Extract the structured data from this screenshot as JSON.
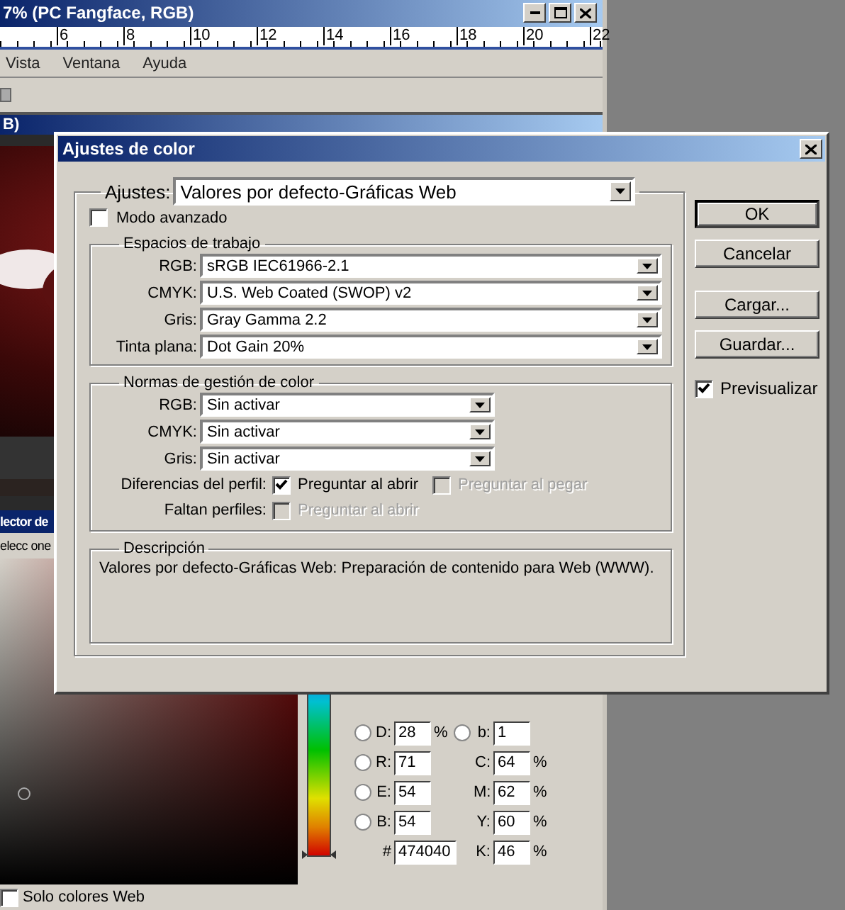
{
  "app_window": {
    "title": "7% (PC Fangface, RGB)",
    "ruler_labels": [
      "6",
      "8",
      "10",
      "12",
      "14",
      "16",
      "18",
      "20",
      "22"
    ],
    "menu": [
      "Vista",
      "Ventana",
      "Ayuda"
    ],
    "document_title": "B)",
    "canvas": {
      "kind": "picture"
    }
  },
  "color_picker": {
    "title": "lector de",
    "subtitle": "elecc one",
    "rows": [
      {
        "left": {
          "kind": "radio",
          "label": "D:",
          "value": "28",
          "unit": "%",
          "selected": false
        },
        "right": {
          "kind": "radio",
          "label": "b:",
          "value": "1",
          "selected": false
        }
      },
      {
        "left": {
          "kind": "radio",
          "label": "R:",
          "value": "71",
          "selected": false
        },
        "right": {
          "kind": "plain",
          "label": "C:",
          "value": "64",
          "unit": "%"
        }
      },
      {
        "left": {
          "kind": "radio",
          "label": "E:",
          "value": "54",
          "selected": false
        },
        "right": {
          "kind": "plain",
          "label": "M:",
          "value": "62",
          "unit": "%"
        }
      },
      {
        "left": {
          "kind": "radio",
          "label": "B:",
          "value": "54",
          "selected": false
        },
        "right": {
          "kind": "plain",
          "label": "Y:",
          "value": "60",
          "unit": "%"
        }
      },
      {
        "left": {
          "kind": "hex",
          "label": "#",
          "value": "474040"
        },
        "right": {
          "kind": "plain",
          "label": "K:",
          "value": "46",
          "unit": "%"
        }
      }
    ],
    "hue_slider": {
      "level": 0
    },
    "web_only": {
      "label": "Solo colores Web",
      "checked": false
    }
  },
  "dialog": {
    "title": "Ajustes de color",
    "settings": {
      "label": "Ajustes:",
      "value": "Valores por defecto-Gráficas Web"
    },
    "advanced_mode": {
      "label": "Modo avanzado",
      "checked": false
    },
    "working_spaces": {
      "title": "Espacios de trabajo",
      "rows": [
        {
          "label": "RGB:",
          "value": "sRGB IEC61966-2.1"
        },
        {
          "label": "CMYK:",
          "value": "U.S. Web Coated (SWOP) v2"
        },
        {
          "label": "Gris:",
          "value": "Gray Gamma 2.2"
        },
        {
          "label": "Tinta plana:",
          "value": "Dot Gain 20%"
        }
      ]
    },
    "policies": {
      "title": "Normas de gestión de color",
      "rows": [
        {
          "label": "RGB:",
          "value": "Sin activar"
        },
        {
          "label": "CMYK:",
          "value": "Sin activar"
        },
        {
          "label": "Gris:",
          "value": "Sin activar"
        }
      ],
      "checks": [
        {
          "label": "Diferencias del perfil:",
          "options": [
            {
              "label": "Preguntar al abrir",
              "checked": true,
              "disabled": false
            },
            {
              "label": "Preguntar al pegar",
              "checked": false,
              "disabled": true
            }
          ]
        },
        {
          "label": "Faltan perfiles:",
          "options": [
            {
              "label": "Preguntar al abrir",
              "checked": false,
              "disabled": true
            }
          ]
        }
      ]
    },
    "description": {
      "title": "Descripción",
      "text": "Valores por defecto-Gráficas Web:  Preparación de contenido para Web (WWW)."
    },
    "buttons": [
      {
        "label": "OK",
        "default": true
      },
      {
        "label": "Cancelar",
        "default": false
      },
      {
        "label": "Cargar...",
        "default": false
      },
      {
        "label": "Guardar...",
        "default": false
      }
    ],
    "preview": {
      "label": "Previsualizar",
      "checked": true
    }
  }
}
